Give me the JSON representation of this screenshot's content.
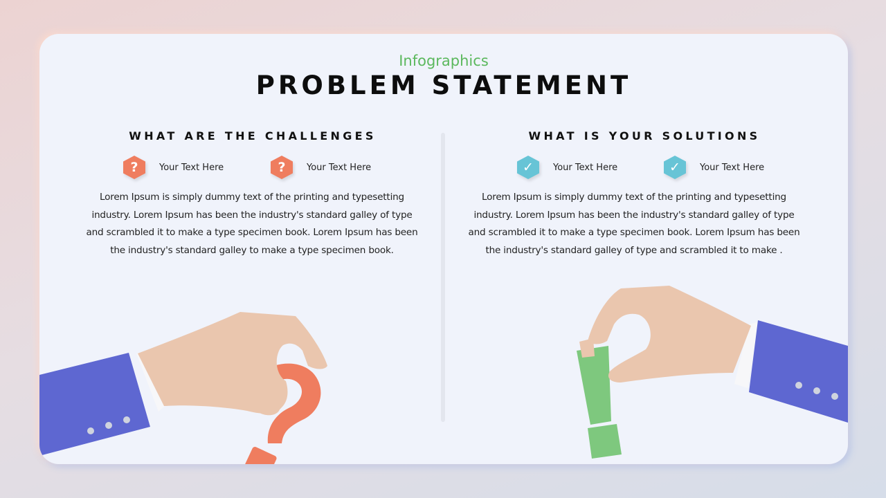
{
  "header": {
    "subtitle": "Infographics",
    "title": "PROBLEM STATEMENT"
  },
  "colors": {
    "accent_green": "#5bb85d",
    "challenge_orange": "#ef7d5f",
    "solution_teal": "#67c4d6",
    "sleeve_blue": "#5e67d1",
    "skin": "#eac6ae",
    "exclamation_green": "#7ec87e"
  },
  "challenges": {
    "heading": "WHAT ARE THE CHALLENGES",
    "icon": "question-hexagon-icon",
    "items": [
      {
        "label": "Your Text Here",
        "glyph": "?"
      },
      {
        "label": "Your Text Here",
        "glyph": "?"
      }
    ],
    "body": "Lorem Ipsum is simply dummy text of the printing and typesetting industry. Lorem Ipsum has been the industry's standard galley of type and scrambled it to make a type specimen book. Lorem Ipsum has been the industry's standard galley to make a type specimen book."
  },
  "solutions": {
    "heading": "WHAT IS YOUR SOLUTIONS",
    "icon": "checkmark-hexagon-icon",
    "items": [
      {
        "label": "Your Text Here",
        "glyph": "✓"
      },
      {
        "label": "Your Text Here",
        "glyph": "✓"
      }
    ],
    "body": "Lorem Ipsum is simply dummy text of the printing and typesetting industry. Lorem Ipsum has been the industry's standard galley of type and scrambled it to make a type specimen book. Lorem Ipsum has been the industry's standard galley of type and scrambled it to make ."
  }
}
